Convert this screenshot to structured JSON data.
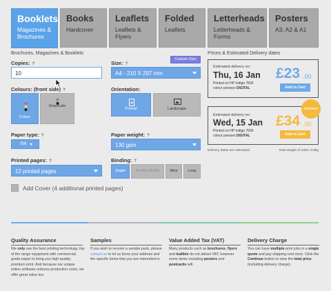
{
  "tabs": [
    {
      "title": "Booklets",
      "sub": "Magazines & Brochures"
    },
    {
      "title": "Books",
      "sub": "Hardcover"
    },
    {
      "title": "Leaflets",
      "sub": "Leaflets & Flyers"
    },
    {
      "title": "Folded",
      "sub": "Leaflets"
    },
    {
      "title": "Letterheads",
      "sub": "Letterheads & Forms"
    },
    {
      "title": "Posters",
      "sub": "A3, A2 & A1"
    }
  ],
  "breadcrumb": "Brochures, Magazines & Booklets",
  "copies": {
    "label": "Copies:",
    "help": "?",
    "value": "10"
  },
  "size": {
    "label": "Size:",
    "help": "?",
    "value": "A4 - 210 X 297 mm",
    "custom_button": "Custom Size"
  },
  "colours": {
    "label": "Colours: (front side)",
    "help": "?",
    "options": [
      "Colour",
      "Greyscale"
    ]
  },
  "orientation": {
    "label": "Orientation:",
    "options": [
      "Portrait",
      "Landscape"
    ]
  },
  "paper_type": {
    "label": "Paper type:",
    "help": "?",
    "value": "Silk"
  },
  "paper_weight": {
    "label": "Paper weight:",
    "help": "?",
    "value": "130 gsm"
  },
  "printed_pages": {
    "label": "Printed pages:",
    "help": "?",
    "value": "12 printed pages"
  },
  "binding": {
    "label": "Binding:",
    "help": "?",
    "options": [
      "Staple",
      "Perfect (PUR)",
      "Wire",
      "Loop"
    ]
  },
  "add_cover": {
    "label": "Add Cover (4 additional printed pages)"
  },
  "prices": {
    "heading": "Prices & Estimated Delivery dates",
    "options": [
      {
        "est": "Estimated delivery on:",
        "date": "Thu, 16 Jan",
        "printed1": "Printed on HP Indigo 7600",
        "printed2": "colour presses",
        "press": "DIGITAL",
        "price": "£23",
        "pence": ".00",
        "cart": "Add to Cart",
        "badge": ""
      },
      {
        "est": "Estimated delivery on:",
        "date": "Wed, 15 Jan",
        "printed1": "Printed on HP Indigo 7600",
        "printed2": "colour presses",
        "press": "DIGITAL",
        "price": "£34",
        "pence": ".00",
        "cart": "Add to Cart",
        "badge": "FASTEST"
      }
    ],
    "note_left": "Delivery dates are estimated.",
    "note_right": "Total weight of order: 0.9kg"
  },
  "footer": {
    "quality": {
      "title": "Quality Assurance"
    },
    "samples": {
      "title": "Samples"
    },
    "vat": {
      "title": "Value Added Tax (VAT)"
    },
    "delivery": {
      "title": "Delivery Charge"
    }
  },
  "colors": {
    "accent": "#5ba3e8",
    "orange": "#f5b93c",
    "price_blue": "#6ea9e6"
  }
}
